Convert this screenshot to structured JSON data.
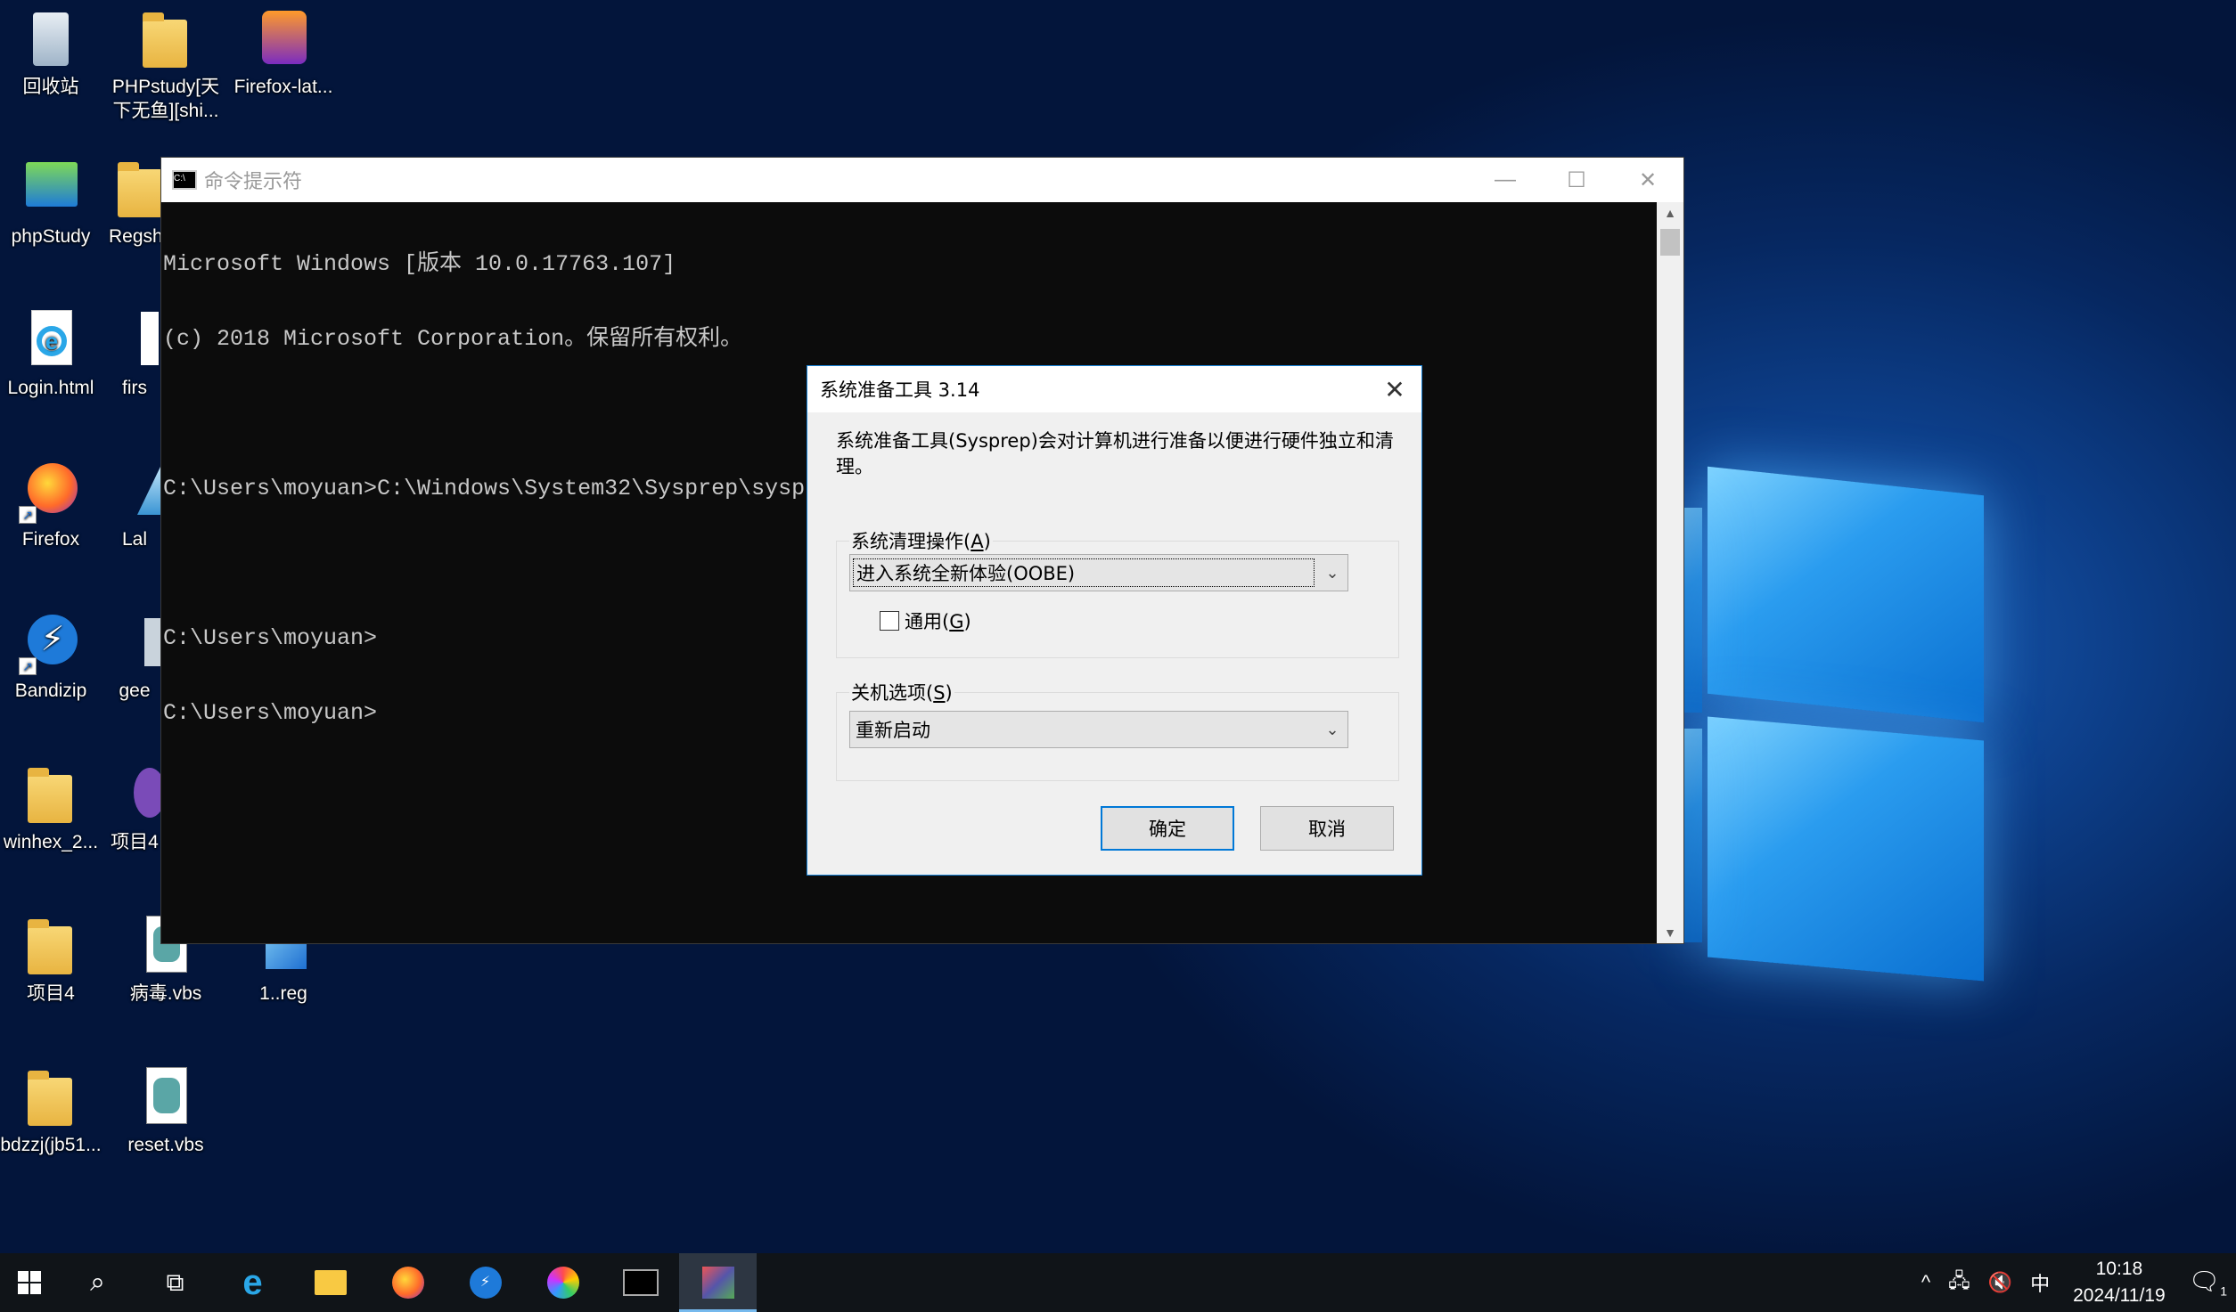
{
  "desktop": {
    "icons": [
      {
        "label": "回收站"
      },
      {
        "label": "PHPstudy[天下无鱼][shi..."
      },
      {
        "label": "Firefox-lat..."
      },
      {
        "label": "phpStudy"
      },
      {
        "label": "Regsh"
      },
      {
        "label": "Login.html"
      },
      {
        "label": "firs"
      },
      {
        "label": "Firefox"
      },
      {
        "label": "Lal"
      },
      {
        "label": "Bandizip"
      },
      {
        "label": "gee"
      },
      {
        "label": "winhex_2..."
      },
      {
        "label": "项目4"
      },
      {
        "label": "项目4"
      },
      {
        "label": "病毒.vbs"
      },
      {
        "label": "1..reg"
      },
      {
        "label": "bdzzj(jb51..."
      },
      {
        "label": "reset.vbs"
      }
    ]
  },
  "cmd_window": {
    "title": "命令提示符",
    "icon_text": "C:\\",
    "lines": [
      "Microsoft Windows [版本 10.0.17763.107]",
      "(c) 2018 Microsoft Corporation。保留所有权利。",
      "",
      "C:\\Users\\moyuan>C:\\Windows\\System32\\Sysprep\\sysprep.exe",
      "",
      "C:\\Users\\moyuan>",
      "C:\\Users\\moyuan>"
    ],
    "minimize": "—",
    "maximize": "☐",
    "close": "✕"
  },
  "sysprep_dialog": {
    "title": "系统准备工具 3.14",
    "close": "✕",
    "description": "系统准备工具(Sysprep)会对计算机进行准备以便进行硬件独立和清理。",
    "cleanup_group": {
      "label": "系统清理操作",
      "accel": "A",
      "selected": "进入系统全新体验(OOBE)",
      "generalize": {
        "label": "通用",
        "accel": "G",
        "checked": false
      }
    },
    "shutdown_group": {
      "label": "关机选项",
      "accel": "S",
      "selected": "重新启动"
    },
    "ok_label": "确定",
    "cancel_label": "取消"
  },
  "taskbar": {
    "items": [
      "start-icon",
      "search-icon",
      "task-view-icon",
      "ie-icon",
      "file-explorer-icon",
      "firefox-icon",
      "bandizip-icon",
      "browser-icon",
      "cmd-icon",
      "sysprep-icon"
    ],
    "tray": {
      "chevron": "^",
      "ime": "中",
      "time": "10:18",
      "date": "2024/11/19",
      "notification_count": "1"
    }
  }
}
